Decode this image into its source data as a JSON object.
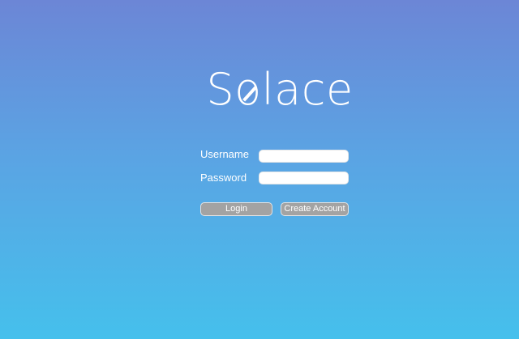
{
  "app": {
    "title": "Solace",
    "title_start": "S",
    "title_o": "o",
    "title_end": "lace"
  },
  "form": {
    "username_label": "Username",
    "username_value": "",
    "password_label": "Password",
    "password_value": ""
  },
  "buttons": {
    "login_label": "Login",
    "create_account_label": "Create Account"
  },
  "colors": {
    "background_top": "#6c86d6",
    "background_bottom": "#45c0ec",
    "button_fill": "#a3a3a3",
    "text": "#ffffff"
  }
}
